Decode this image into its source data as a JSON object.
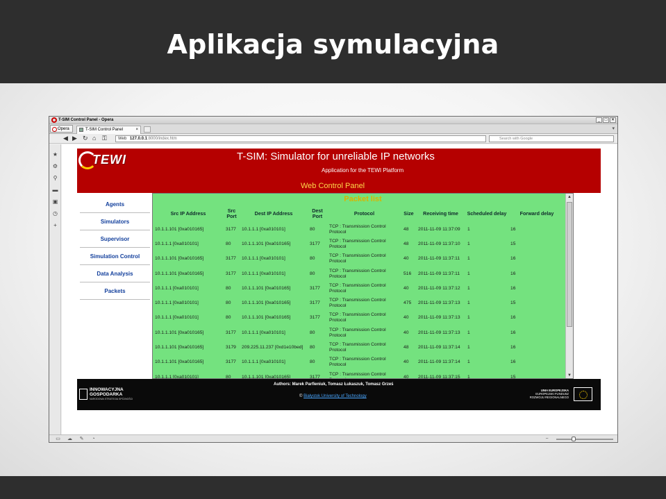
{
  "slide": {
    "title": "Aplikacja symulacyjna"
  },
  "browser": {
    "window_title": "T-SIM Control Panel - Opera",
    "opera_menu_label": "Opera",
    "tab_title": "T-SIM Control Panel",
    "url_prefix": "Web",
    "url_host": "127.0.0.1",
    "url_path": ":8000/index.htm",
    "search_placeholder": "Search with Google",
    "window_buttons": [
      "_",
      "□",
      "✕"
    ]
  },
  "page": {
    "logo_text": "TEWI",
    "title": "T-SIM: Simulator for unreliable IP networks",
    "subtitle": "Application for the TEWI Platform",
    "panel_label": "Web Control Panel",
    "nav_items": [
      "Agents",
      "Simulators",
      "Supervisor",
      "Simulation Control",
      "Data Analysis",
      "Packets"
    ],
    "packet_list_title": "Packet list",
    "table_headers": [
      "Src IP Address",
      "Src Port",
      "Dest IP Address",
      "Dest Port",
      "Protocol",
      "Size",
      "Receiving time",
      "Scheduled delay",
      "Forward delay"
    ],
    "rows": [
      [
        "10.1.1.101 [0xa010165]",
        "3177",
        "10.1.1.1 [0xa010101]",
        "80",
        "TCP : Transmission Control Protocol",
        "48",
        "2011-11-09 11:37:09",
        "1",
        "16"
      ],
      [
        "10.1.1.1 [0xa010101]",
        "80",
        "10.1.1.101 [0xa010165]",
        "3177",
        "TCP : Transmission Control Protocol",
        "48",
        "2011-11-09 11:37:10",
        "1",
        "15"
      ],
      [
        "10.1.1.101 [0xa010165]",
        "3177",
        "10.1.1.1 [0xa010101]",
        "80",
        "TCP : Transmission Control Protocol",
        "40",
        "2011-11-09 11:37:11",
        "1",
        "16"
      ],
      [
        "10.1.1.101 [0xa010165]",
        "3177",
        "10.1.1.1 [0xa010101]",
        "80",
        "TCP : Transmission Control Protocol",
        "516",
        "2011-11-09 11:37:11",
        "1",
        "16"
      ],
      [
        "10.1.1.1 [0xa010101]",
        "80",
        "10.1.1.101 [0xa010165]",
        "3177",
        "TCP : Transmission Control Protocol",
        "40",
        "2011-11-09 11:37:12",
        "1",
        "16"
      ],
      [
        "10.1.1.1 [0xa010101]",
        "80",
        "10.1.1.101 [0xa010165]",
        "3177",
        "TCP : Transmission Control Protocol",
        "475",
        "2011-11-09 11:37:13",
        "1",
        "15"
      ],
      [
        "10.1.1.1 [0xa010101]",
        "80",
        "10.1.1.101 [0xa010165]",
        "3177",
        "TCP : Transmission Control Protocol",
        "40",
        "2011-11-09 11:37:13",
        "1",
        "16"
      ],
      [
        "10.1.1.101 [0xa010165]",
        "3177",
        "10.1.1.1 [0xa010101]",
        "80",
        "TCP : Transmission Control Protocol",
        "40",
        "2011-11-09 11:37:13",
        "1",
        "16"
      ],
      [
        "10.1.1.101 [0xa010165]",
        "3179",
        "209.225.11.237 [0xd1e10bed]",
        "80",
        "TCP : Transmission Control Protocol",
        "48",
        "2011-11-09 11:37:14",
        "1",
        "16"
      ],
      [
        "10.1.1.101 [0xa010165]",
        "3177",
        "10.1.1.1 [0xa010101]",
        "80",
        "TCP : Transmission Control Protocol",
        "40",
        "2011-11-09 11:37:14",
        "1",
        "16"
      ],
      [
        "10.1.1.1 [0xa010101]",
        "80",
        "10.1.1.101 [0xa010165]",
        "3177",
        "TCP : Transmission Control Protocol",
        "40",
        "2011-11-09 11:37:15",
        "1",
        "15"
      ]
    ],
    "footer_authors": "Authors: Marek Parfieniuk, Tomasz Łukaszuk, Tomasz Grześ",
    "footer_copyright": "©",
    "footer_university": "Białystok University of Technology",
    "eu_left_line1": "INNOWACYJNA",
    "eu_left_line2": "GOSPODARKA",
    "eu_left_line3": "NARODOWA STRATEGIA SPÓJNOŚCI",
    "eu_right_line1": "UNIA EUROPEJSKA",
    "eu_right_line2": "EUROPEJSKI FUNDUSZ",
    "eu_right_line3": "ROZWOJU REGIONALNEGO"
  },
  "icons": {
    "sidebar": [
      "bookmark-icon",
      "gear-icon",
      "share-icon",
      "notes-icon",
      "panel-icon",
      "history-icon",
      "add-icon"
    ],
    "status": [
      "speed-dial-icon",
      "cloud-icon",
      "unite-icon",
      "turbo-icon"
    ]
  }
}
